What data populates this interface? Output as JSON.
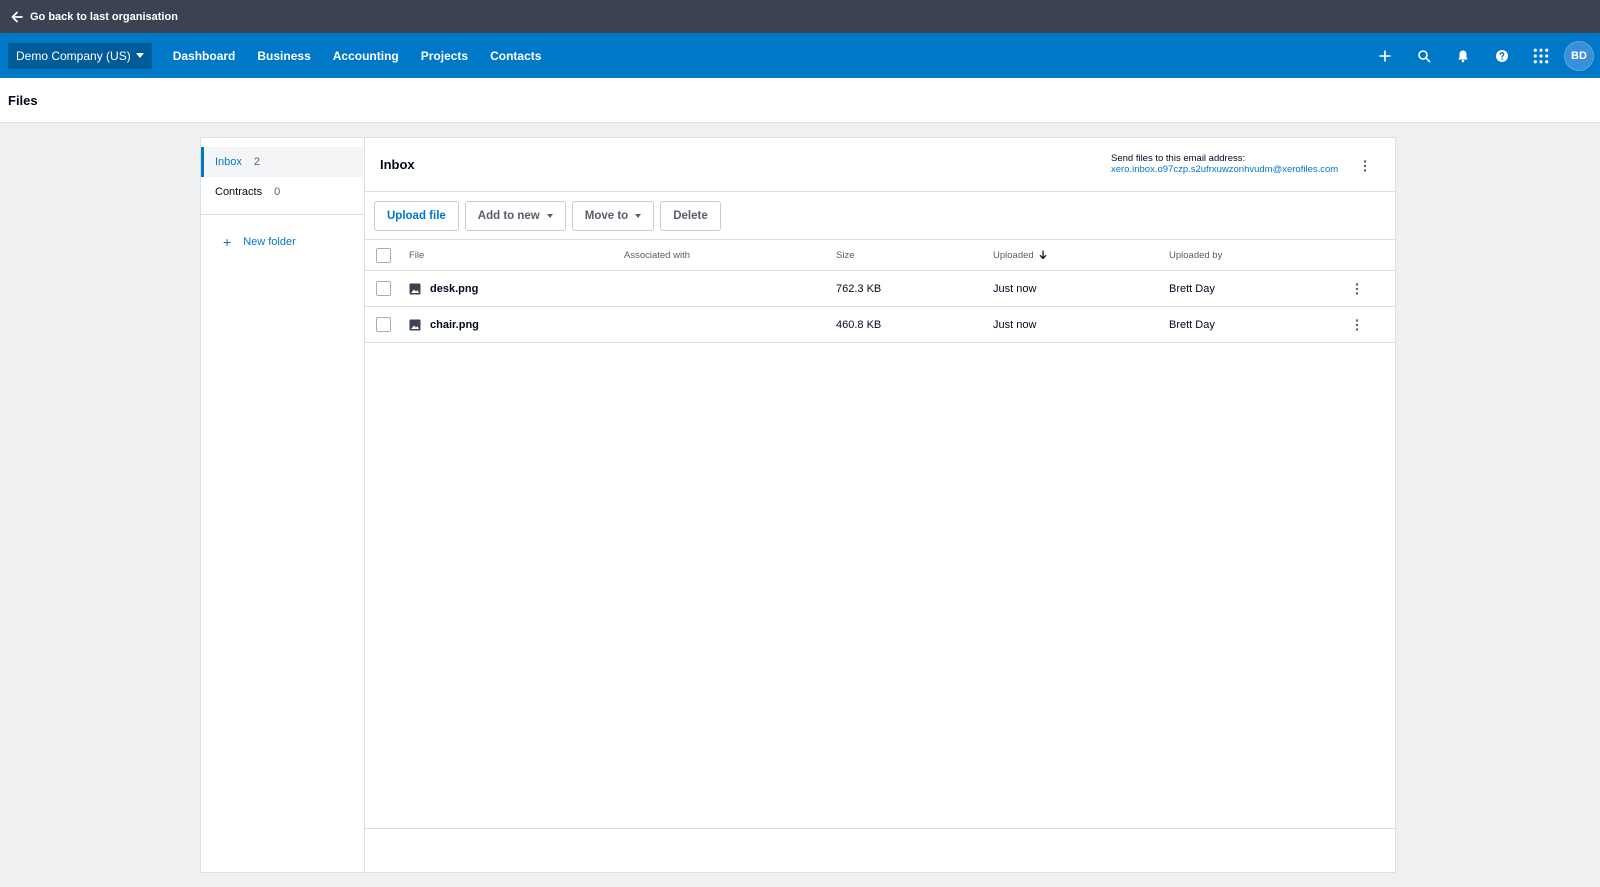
{
  "topbar": {
    "back_label": "Go back to last organisation"
  },
  "navbar": {
    "org_name": "Demo Company (US)",
    "links": [
      "Dashboard",
      "Business",
      "Accounting",
      "Projects",
      "Contacts"
    ],
    "icons": [
      "plus-icon",
      "search-icon",
      "bell-icon",
      "help-icon",
      "apps-grid-icon"
    ],
    "avatar_initials": "BD"
  },
  "page": {
    "title": "Files"
  },
  "sidebar": {
    "folders": [
      {
        "name": "Inbox",
        "count": "2"
      },
      {
        "name": "Contracts",
        "count": "0"
      }
    ],
    "new_folder_label": "New folder"
  },
  "main": {
    "title": "Inbox",
    "email_label": "Send files to this email address:",
    "email_address": "xero.inbox.o97czp.s2ufrxuwzonhvudm@xerofiles.com",
    "toolbar": {
      "upload": "Upload file",
      "add_to_new": "Add to new",
      "move_to": "Move to",
      "delete": "Delete"
    },
    "columns": {
      "file": "File",
      "associated": "Associated with",
      "size": "Size",
      "uploaded": "Uploaded",
      "uploaded_by": "Uploaded by"
    },
    "rows": [
      {
        "file": "desk.png",
        "associated": "",
        "size": "762.3 KB",
        "uploaded": "Just now",
        "uploaded_by": "Brett Day"
      },
      {
        "file": "chair.png",
        "associated": "",
        "size": "460.8 KB",
        "uploaded": "Just now",
        "uploaded_by": "Brett Day"
      }
    ]
  },
  "colors": {
    "brand": "#0078c8",
    "topbar": "#3b4352",
    "org_button": "#005c99"
  }
}
